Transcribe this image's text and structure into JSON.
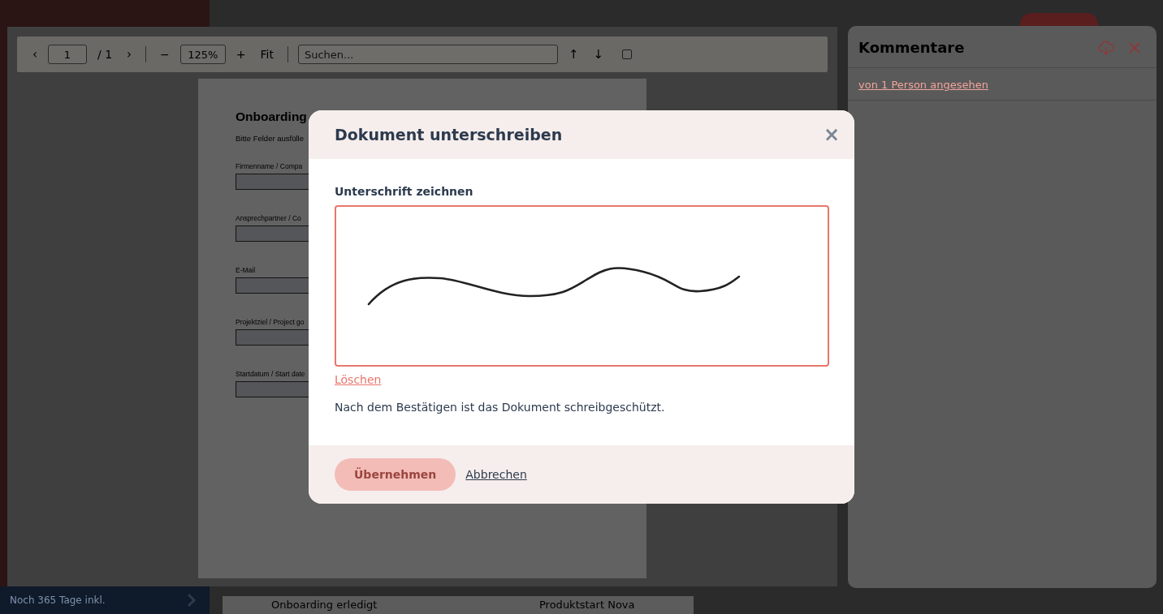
{
  "background_app": {
    "promo": "Noch 365 Tage inkl.",
    "bottom_row": [
      "Onboarding erledigt",
      "Produktstart Nova"
    ]
  },
  "pdf_viewer": {
    "toolbar": {
      "prev": "‹",
      "page": "1",
      "page_total": "/ 1",
      "next": "›",
      "zoom_out": "−",
      "zoom": "125%",
      "zoom_in": "+",
      "fit": "Fit",
      "search_placeholder": "Suchen...",
      "search_up": "↑",
      "search_down": "↓"
    },
    "document": {
      "title": "Onboarding",
      "intro": "Bitte Felder ausfülle",
      "fields": [
        "Firmenname / Compa",
        "Ansprechpartner / Co",
        "E-Mail",
        "Projektziel / Project go",
        "Startdatum / Start date"
      ]
    }
  },
  "comments": {
    "title": "Kommentare",
    "seen_link": "von 1 Person angesehen"
  },
  "dialog": {
    "title": "Dokument unterschreiben",
    "close": "×",
    "label": "Unterschrift zeichnen",
    "signature_drawn": true,
    "clear_link": "Löschen",
    "note": "Nach dem Bestätigen ist das Dokument schreibgeschützt.",
    "confirm": {
      "label": "Übernehmen",
      "disabled": true
    },
    "cancel": "Abbrechen"
  }
}
